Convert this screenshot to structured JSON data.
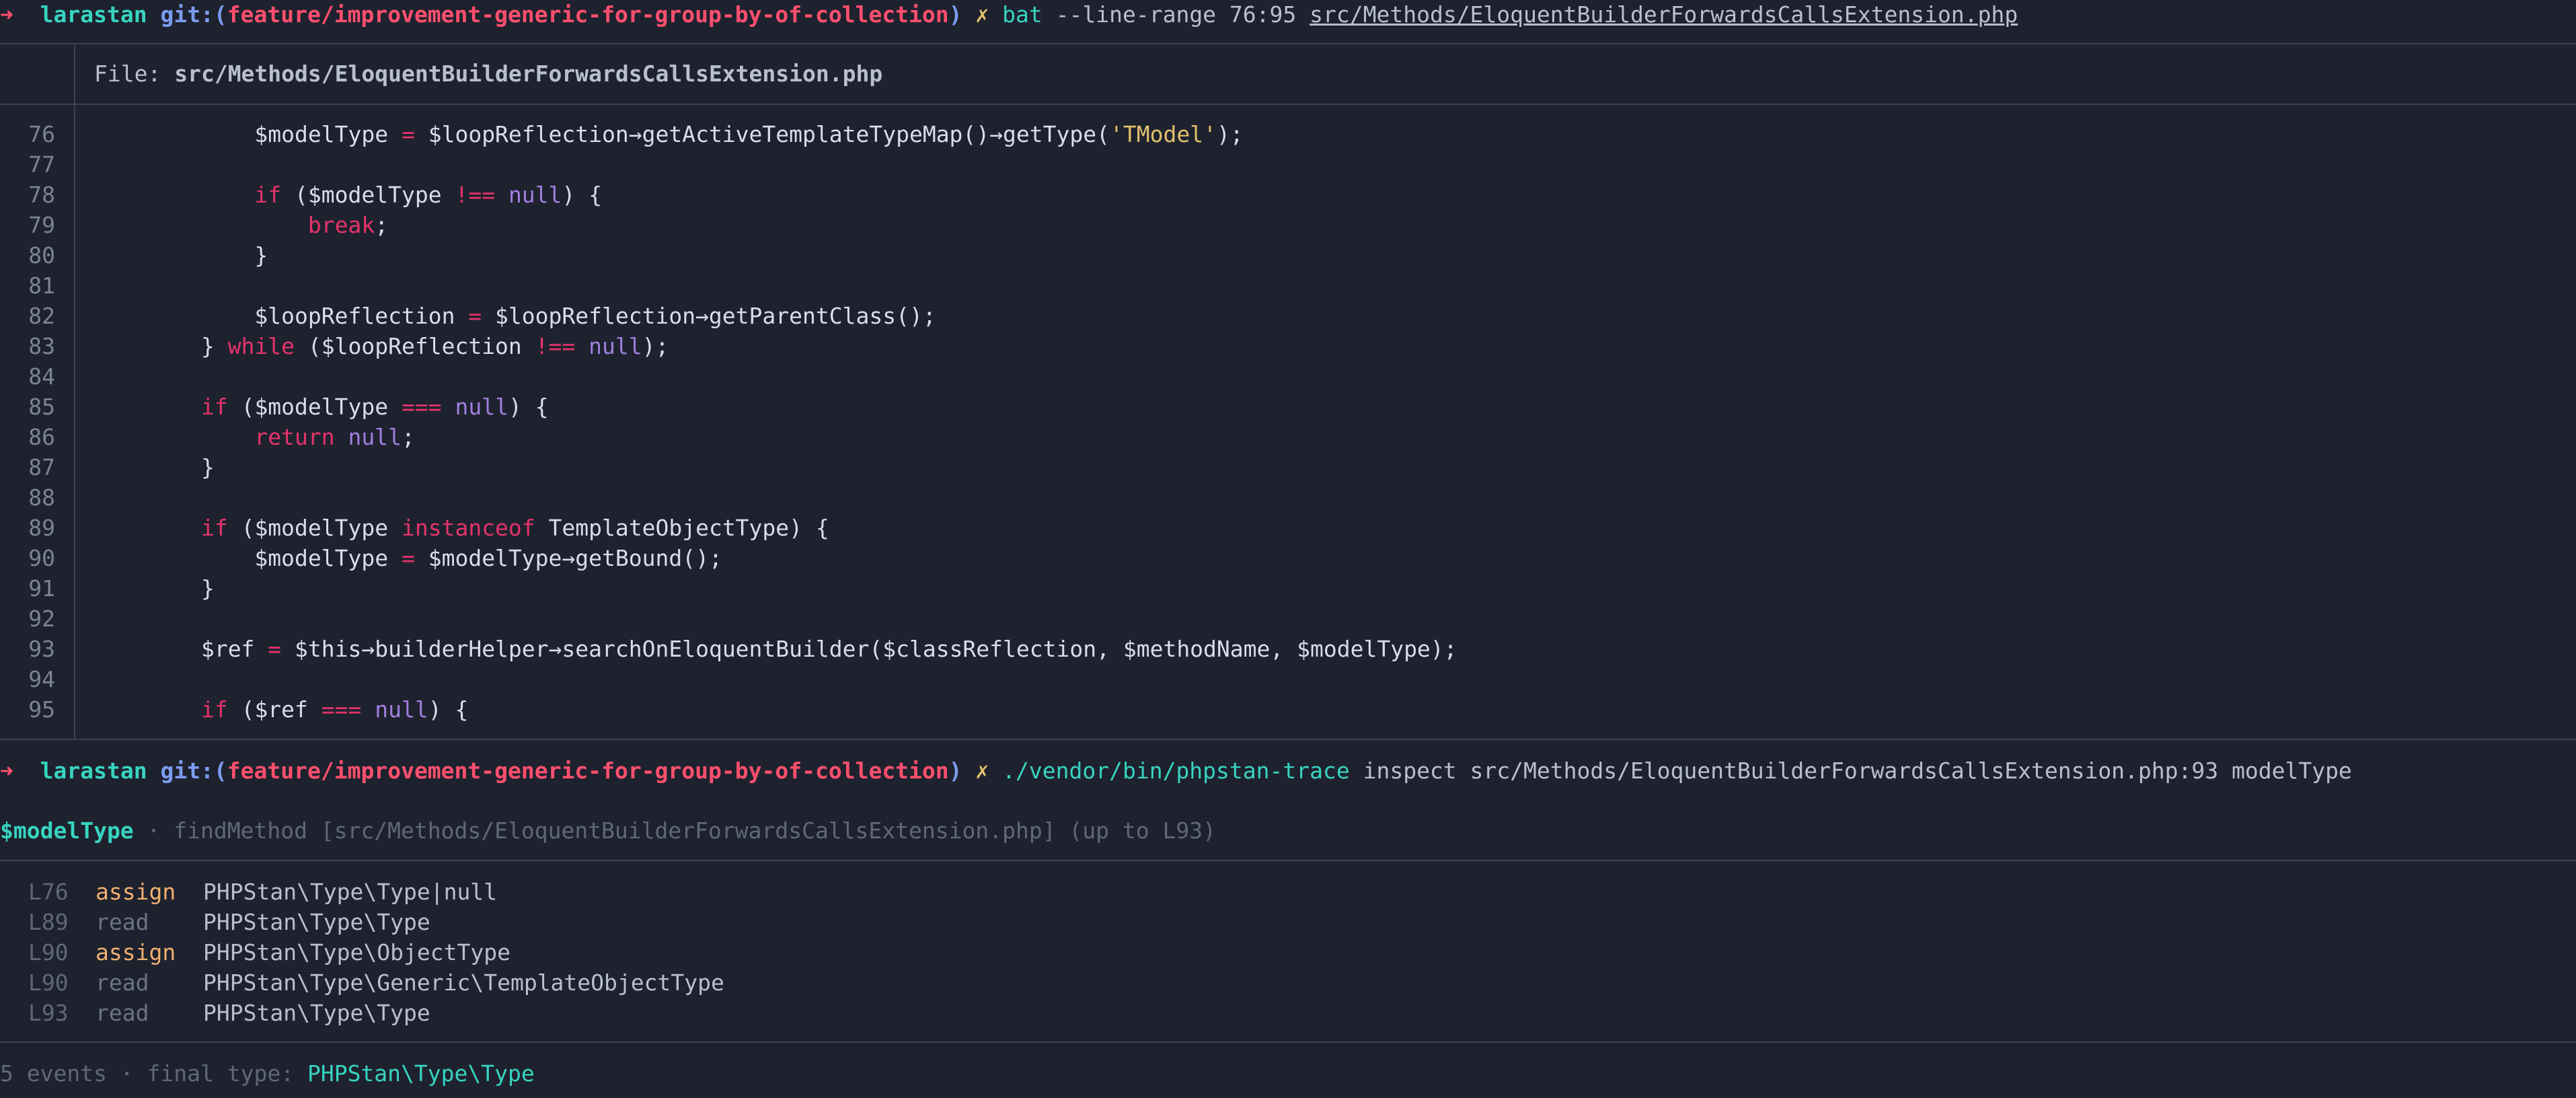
{
  "prompt1": {
    "arrow": "➜",
    "repo": "larastan",
    "git_prefix": "git:(",
    "branch": "feature/improvement-generic-for-group-by-of-collection",
    "git_suffix": ")",
    "dirty": "✗",
    "command": "bat",
    "args": "--line-range 76:95",
    "file": "src/Methods/EloquentBuilderForwardsCallsExtension.php"
  },
  "bat_header": {
    "label": "File: ",
    "file": "src/Methods/EloquentBuilderForwardsCallsExtension.php"
  },
  "code_lines": [
    {
      "n": "76"
    },
    {
      "n": "77"
    },
    {
      "n": "78"
    },
    {
      "n": "79"
    },
    {
      "n": "80"
    },
    {
      "n": "81"
    },
    {
      "n": "82"
    },
    {
      "n": "83"
    },
    {
      "n": "84"
    },
    {
      "n": "85"
    },
    {
      "n": "86"
    },
    {
      "n": "87"
    },
    {
      "n": "88"
    },
    {
      "n": "89"
    },
    {
      "n": "90"
    },
    {
      "n": "91"
    },
    {
      "n": "92"
    },
    {
      "n": "93"
    },
    {
      "n": "94"
    },
    {
      "n": "95"
    }
  ],
  "code": {
    "l76": {
      "indent": "            ",
      "v1": "$modelType",
      "eq": " = ",
      "v2": "$loopReflection",
      "m": "→getActiveTemplateTypeMap()→getType(",
      "s": "'TModel'",
      "end": ");"
    },
    "l78": {
      "indent": "            ",
      "kw": "if",
      "a": " ($modelType ",
      "op": "!==",
      "b": " ",
      "nl": "null",
      "c": ") {"
    },
    "l79": {
      "indent": "                ",
      "kw": "break",
      "c": ";"
    },
    "l80": {
      "text": "            }"
    },
    "l82": {
      "indent": "            ",
      "v1": "$loopReflection",
      "eq": " = ",
      "rest": "$loopReflection→getParentClass();"
    },
    "l83": {
      "indent": "        ",
      "a": "} ",
      "kw": "while",
      "b": " ($loopReflection ",
      "op": "!==",
      "c": " ",
      "nl": "null",
      "d": ");"
    },
    "l85": {
      "indent": "        ",
      "kw": "if",
      "a": " ($modelType ",
      "op": "===",
      "b": " ",
      "nl": "null",
      "c": ") {"
    },
    "l86": {
      "indent": "            ",
      "kw": "return",
      "a": " ",
      "nl": "null",
      "c": ";"
    },
    "l87": {
      "text": "        }"
    },
    "l89": {
      "indent": "        ",
      "kw": "if",
      "a": " ($modelType ",
      "kw2": "instanceof",
      "b": " TemplateObjectType) {"
    },
    "l90": {
      "indent": "            ",
      "v1": "$modelType",
      "eq": " = ",
      "rest": "$modelType→getBound();"
    },
    "l91": {
      "text": "        }"
    },
    "l93": {
      "indent": "        ",
      "v1": "$ref",
      "eq": " = ",
      "rest": "$this→builderHelper→searchOnEloquentBuilder($classReflection, $methodName, $modelType);"
    },
    "l95": {
      "indent": "        ",
      "kw": "if",
      "a": " ($ref ",
      "op": "===",
      "b": " ",
      "nl": "null",
      "c": ") {"
    }
  },
  "prompt2": {
    "arrow": "➜",
    "repo": "larastan",
    "git_prefix": "git:(",
    "branch": "feature/improvement-generic-for-group-by-of-collection",
    "git_suffix": ")",
    "dirty": "✗",
    "command": "./vendor/bin/phpstan-trace",
    "args": "inspect src/Methods/EloquentBuilderForwardsCallsExtension.php:93 modelType"
  },
  "trace": {
    "variable": "$modelType",
    "context": " · findMethod [src/Methods/EloquentBuilderForwardsCallsExtension.php] (up to L93)",
    "events": [
      {
        "line": "L76",
        "kind": "assign",
        "type": "PHPStan\\Type\\Type|null"
      },
      {
        "line": "L89",
        "kind": "read",
        "type": "PHPStan\\Type\\Type"
      },
      {
        "line": "L90",
        "kind": "assign",
        "type": "PHPStan\\Type\\ObjectType"
      },
      {
        "line": "L90",
        "kind": "read",
        "type": "PHPStan\\Type\\Generic\\TemplateObjectType"
      },
      {
        "line": "L93",
        "kind": "read",
        "type": "PHPStan\\Type\\Type"
      }
    ],
    "summary_prefix": "5 events · final type: ",
    "final_type": "PHPStan\\Type\\Type"
  }
}
